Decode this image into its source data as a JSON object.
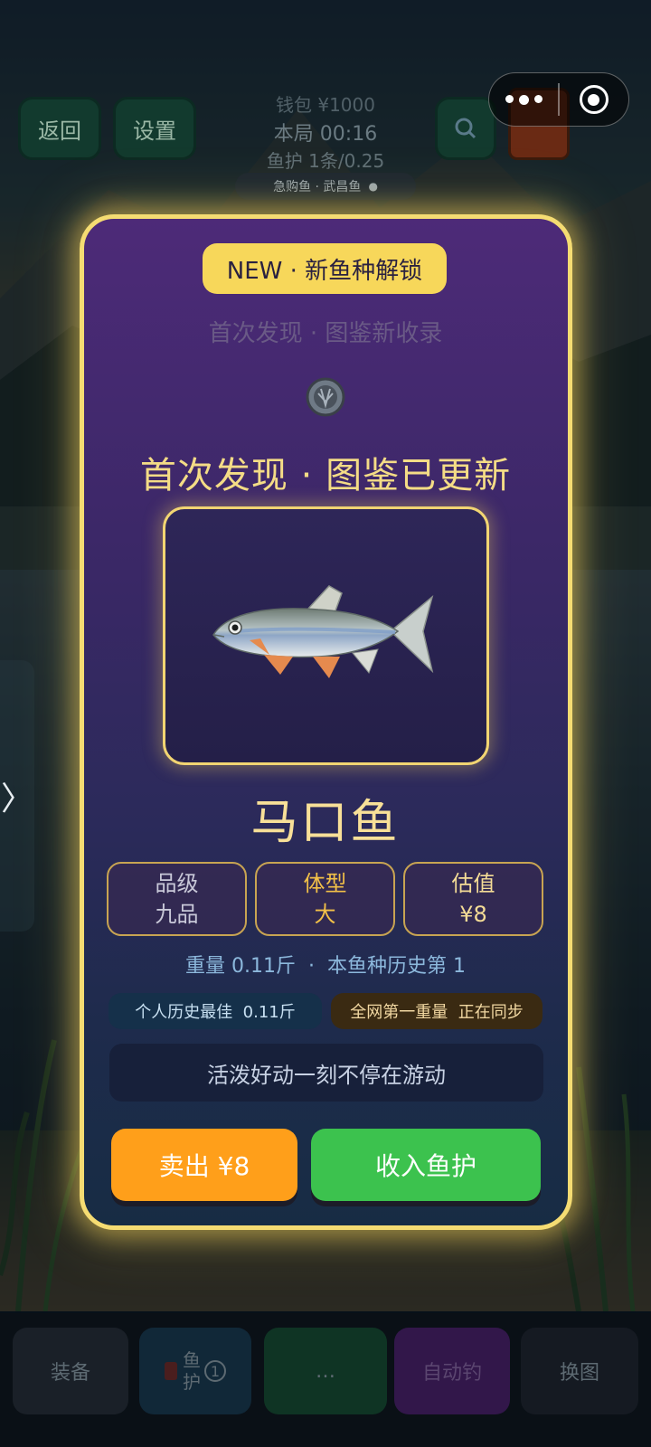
{
  "hud": {
    "back_label": "返回",
    "left2_label": "设置",
    "money": "钱包 ¥1000",
    "session": "本局 00:16",
    "keepnet": "鱼护 1条/0.25",
    "target": "急购鱼 · 武昌鱼"
  },
  "side": {
    "arrow": "〉"
  },
  "modal": {
    "badge": "NEW · 新鱼种解锁",
    "first_found": "首次发现 · 图鉴新收录",
    "headline": "首次发现 · 图鉴已更新",
    "fish_name": "马口鱼",
    "stats": [
      {
        "key": "品级",
        "value": "九品"
      },
      {
        "key": "体型",
        "value": "大"
      },
      {
        "key": "估值",
        "value": "¥8"
      }
    ],
    "weight_line": "重量 0.11斤  ·  本鱼种历史第 1",
    "personal_best": "个人历史最佳  0.11斤",
    "global_best": "全网第一重量  正在同步",
    "description": "活泼好动一刻不停在游动",
    "sell_label": "卖出 ¥8",
    "keep_label": "收入鱼护"
  },
  "bottom": {
    "equip": "装备",
    "keepnet": "鱼\n护",
    "keepnet_count": "1",
    "center": "…",
    "auto": "自动钓",
    "swap": "换图"
  },
  "colors": {
    "accent_gold": "#f5dc72",
    "sell_orange": "#ff9f1a",
    "keep_green": "#3cc24e"
  }
}
